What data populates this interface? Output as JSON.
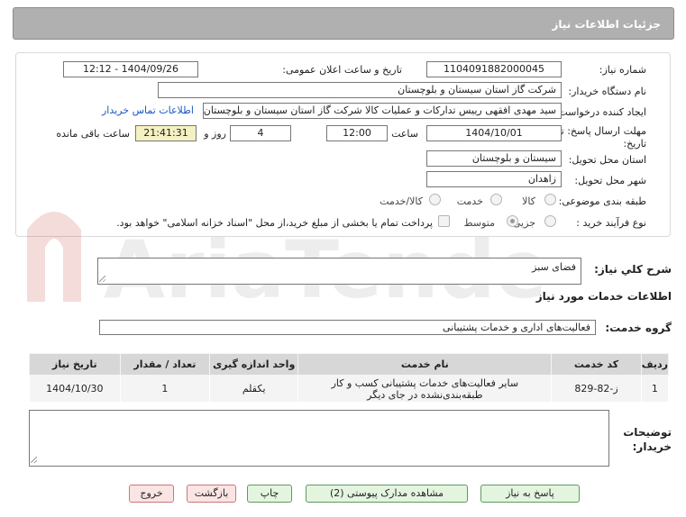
{
  "header": {
    "title": "جزئیات اطلاعات نیاز"
  },
  "fields": {
    "need_number_label": "شماره نیاز:",
    "need_number": "1104091882000045",
    "announce_label": "تاریخ و ساعت اعلان عمومی:",
    "announce_value": "1404/09/26 - 12:12",
    "buyer_org_label": "نام دستگاه خریدار:",
    "buyer_org": "شرکت گاز استان سیستان و بلوچستان",
    "creator_label": "ایجاد کننده درخواست:",
    "creator": "سید مهدی افقهی رییس تدارکات و عملیات کالا شرکت گاز استان سیستان و بلوچستان",
    "contact_link": "اطلاعات تماس خریدار",
    "deadline_label": "مهلت ارسال پاسخ: تا تاریخ:",
    "deadline_date": "1404/10/01",
    "time_label": "ساعت",
    "deadline_time": "12:00",
    "days_value": "4",
    "days_label": "روز و",
    "remaining_time": "21:41:31",
    "remaining_label": "ساعت باقی مانده",
    "province_label": "استان محل تحویل:",
    "province": "سیستان و بلوچستان",
    "city_label": "شهر محل تحویل:",
    "city": "زاهدان",
    "category_label": "طبقه بندی موضوعی:",
    "category_options": [
      "کالا",
      "خدمت",
      "کالا/خدمت"
    ],
    "purchase_type_label": "نوع فرآیند خرید :",
    "purchase_options": [
      "جزیی",
      "متوسط"
    ],
    "payment_note": "پرداخت تمام یا بخشی از مبلغ خرید،از محل \"اسناد خزانه اسلامی\" خواهد بود."
  },
  "description": {
    "label": "شرح کلي نياز:",
    "value": "فضای سبز"
  },
  "services": {
    "section_title": "اطلاعات خدمات مورد نیاز",
    "group_label": "گروه خدمت:",
    "group_value": "فعالیت‌های اداری و خدمات پشتیبانی",
    "columns": [
      "ردیف",
      "کد خدمت",
      "نام خدمت",
      "واحد اندازه گیری",
      "تعداد / مقدار",
      "تاریخ نیاز"
    ],
    "rows": [
      {
        "index": "1",
        "code": "ز-82-829",
        "name_line1": "سایر فعالیت‌های خدمات پشتیبانی کسب و کار",
        "name_line2": "طبقه‌بندی‌نشده در جای دیگر",
        "unit": "یکقلم",
        "quantity": "1",
        "date": "1404/10/30"
      }
    ]
  },
  "buyer_notes": {
    "label": "توضیحات خریدار:",
    "value": ""
  },
  "buttons": {
    "reply": "پاسخ به نیاز",
    "docs": "مشاهده مدارک پیوستی (2)",
    "print": "چاپ",
    "back": "بازگشت",
    "exit": "خروج"
  },
  "colors": {
    "header": "#b0b0b0",
    "time_highlight": "#f4f2c2",
    "link": "#1a57c6",
    "button_green": "#e3f5df",
    "button_red": "#fbe4e4"
  }
}
